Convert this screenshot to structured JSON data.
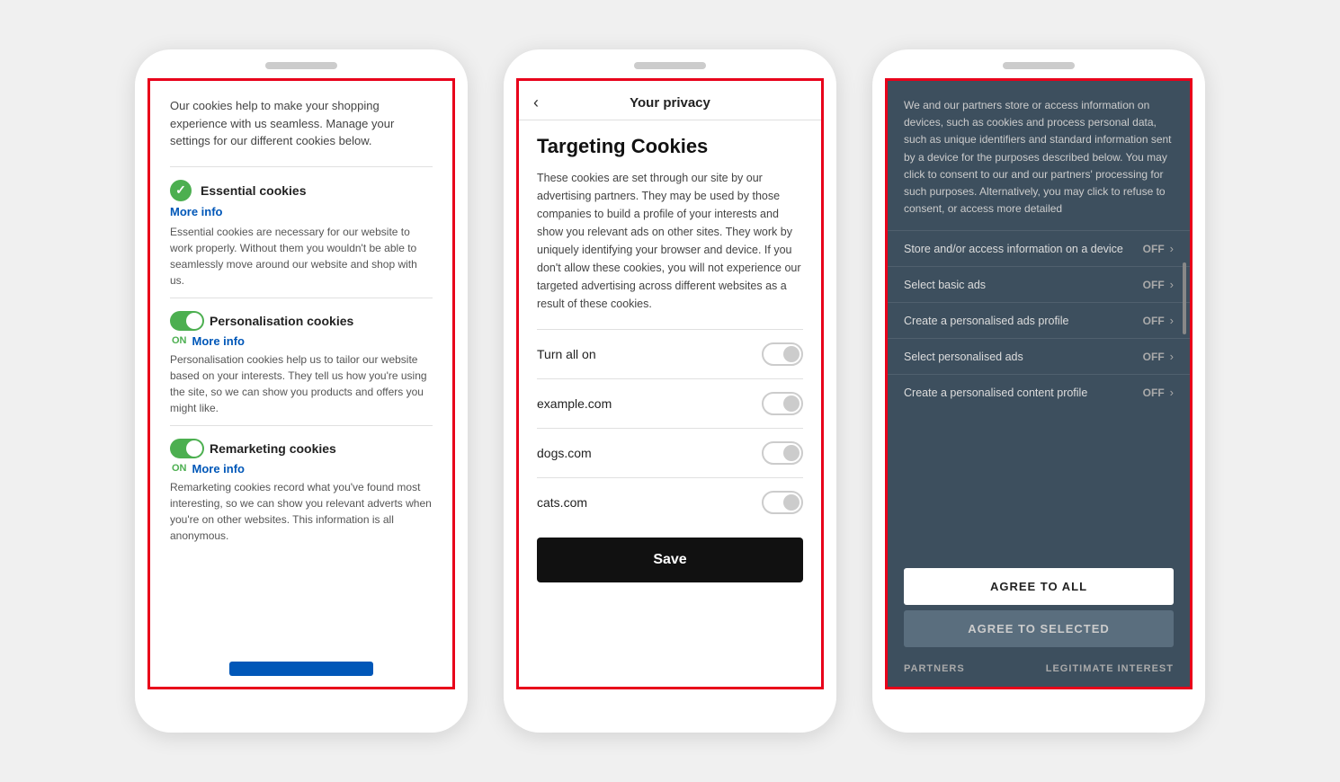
{
  "colors": {
    "red_border": "#e8001a",
    "blue": "#0057b8",
    "green": "#4CAF50",
    "dark_bg": "#3d4f5e",
    "white": "#ffffff",
    "dark_btn": "#111111"
  },
  "phone1": {
    "intro": "Our cookies help to make your shopping experience with us seamless. Manage your settings for our different cookies below.",
    "sections": [
      {
        "id": "essential",
        "title": "Essential cookies",
        "more_info": "More info",
        "toggle_type": "checked",
        "description": "Essential cookies are necessary for our website to work properly. Without them you wouldn't be able to seamlessly move around our website and shop with us."
      },
      {
        "id": "personalisation",
        "title": "Personalisation cookies",
        "more_info": "More info",
        "toggle_type": "on",
        "toggle_label": "ON",
        "description": "Personalisation cookies help us to tailor our website based on your interests. They tell us how you're using the site, so we can show you products and offers you might like."
      },
      {
        "id": "remarketing",
        "title": "Remarketing cookies",
        "more_info": "More info",
        "toggle_type": "on",
        "toggle_label": "ON",
        "description": "Remarketing cookies record what you've found most interesting, so we can show you relevant adverts when you're on other websites. This information is all anonymous."
      }
    ]
  },
  "phone2": {
    "back_label": "‹",
    "header_title": "Your privacy",
    "section_title": "Targeting Cookies",
    "description": "These cookies are set through our site by our advertising partners. They may be used by those companies to build a profile of your interests and show you relevant ads on other sites. They work by uniquely identifying your browser and device. If you don't allow these cookies, you will not experience our targeted advertising across different websites as a result of these cookies.",
    "toggles": [
      {
        "label": "Turn all on"
      },
      {
        "label": "example.com"
      },
      {
        "label": "dogs.com"
      },
      {
        "label": "cats.com"
      }
    ],
    "save_label": "Save"
  },
  "phone3": {
    "description": "We and our partners store or access information on devices, such as cookies and process personal data, such as unique identifiers and standard information sent by a device for the purposes described below. You may click to consent to our and our partners' processing for such purposes. Alternatively, you may click to refuse to consent, or access more detailed",
    "rows": [
      {
        "label": "Store and/or access information on a device",
        "status": "OFF"
      },
      {
        "label": "Select basic ads",
        "status": "OFF"
      },
      {
        "label": "Create a personalised ads profile",
        "status": "OFF"
      },
      {
        "label": "Select personalised ads",
        "status": "OFF"
      },
      {
        "label": "Create a personalised content profile",
        "status": "OFF"
      }
    ],
    "agree_all_label": "AGREE TO ALL",
    "agree_selected_label": "AGREE TO SELECTED",
    "footer_left": "PARTNERS",
    "footer_right": "LEGITIMATE INTEREST"
  }
}
